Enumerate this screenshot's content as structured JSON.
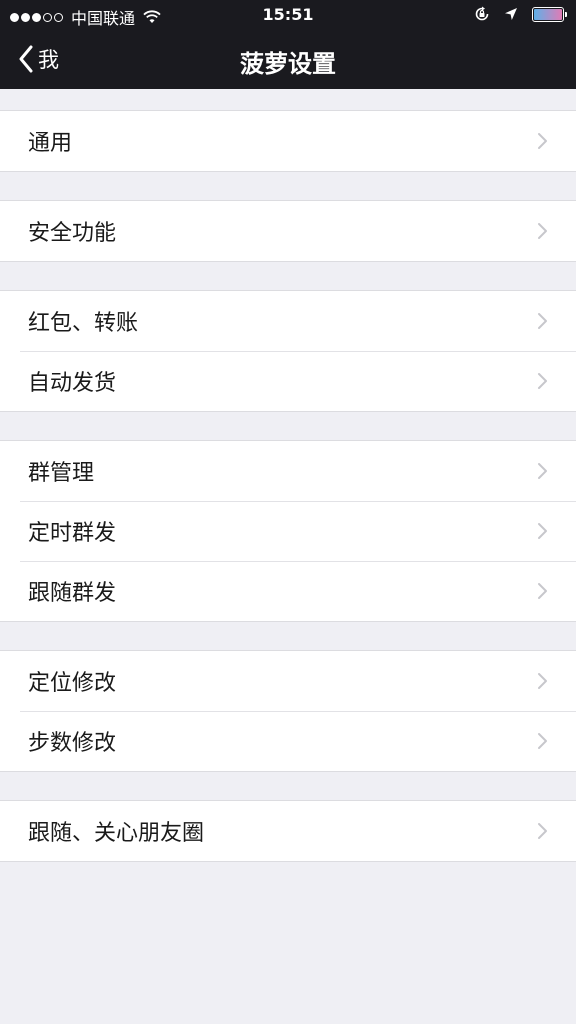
{
  "status_bar": {
    "carrier": "中国联通",
    "time": "15:51",
    "signal_filled": 3,
    "signal_total": 5,
    "battery_level": 1.0
  },
  "nav": {
    "back_label": "我",
    "title": "菠萝设置"
  },
  "groups": [
    {
      "items": [
        {
          "label": "通用"
        }
      ]
    },
    {
      "items": [
        {
          "label": "安全功能"
        }
      ]
    },
    {
      "items": [
        {
          "label": "红包、转账"
        },
        {
          "label": "自动发货"
        }
      ]
    },
    {
      "items": [
        {
          "label": "群管理"
        },
        {
          "label": "定时群发"
        },
        {
          "label": "跟随群发"
        }
      ]
    },
    {
      "items": [
        {
          "label": "定位修改"
        },
        {
          "label": "步数修改"
        }
      ]
    },
    {
      "items": [
        {
          "label": "跟随、关心朋友圈"
        }
      ]
    }
  ],
  "icons": {
    "back": "chevron-left-icon",
    "row_disclosure": "chevron-right-icon",
    "wifi": "wifi-icon",
    "orientation_lock": "orientation-lock-icon",
    "location": "location-arrow-icon",
    "battery": "battery-icon"
  },
  "colors": {
    "bar_background": "#1a1a1f",
    "page_background": "#efeff4",
    "row_background": "#ffffff",
    "chevron": "#c7c7cc"
  }
}
